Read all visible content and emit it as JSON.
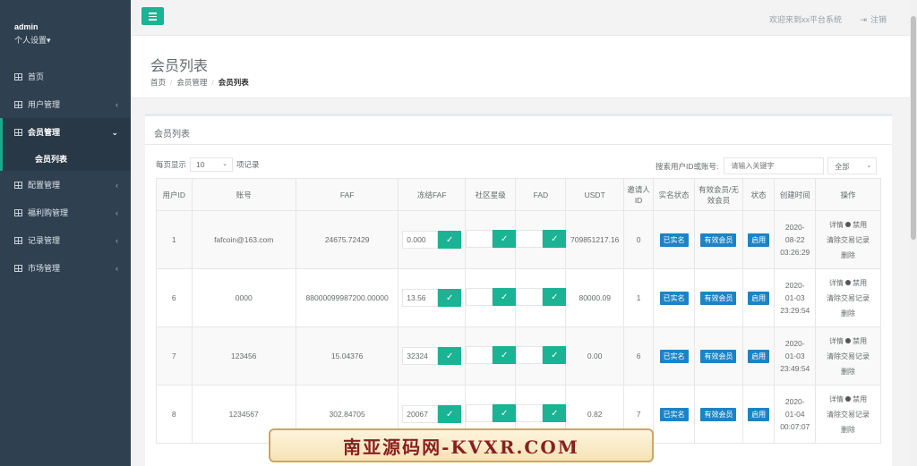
{
  "sidebar": {
    "username": "admin",
    "settings_label": "个人设置",
    "items": [
      {
        "label": "首页",
        "chevron": ""
      },
      {
        "label": "用户管理",
        "chevron": "‹"
      },
      {
        "label": "会员管理",
        "chevron": "⌄"
      },
      {
        "label": "配置管理",
        "chevron": "‹"
      },
      {
        "label": "福利购管理",
        "chevron": "‹"
      },
      {
        "label": "记录管理",
        "chevron": "‹"
      },
      {
        "label": "市场管理",
        "chevron": "‹"
      }
    ],
    "sub_item": "会员列表"
  },
  "topbar": {
    "welcome": "欢迎来到xx平台系统",
    "logout": "注销"
  },
  "heading": {
    "title": "会员列表",
    "breadcrumb": [
      "首页",
      "会员管理",
      "会员列表"
    ]
  },
  "card": {
    "title": "会员列表",
    "page_size_prefix": "每页显示",
    "page_size_value": "10",
    "page_size_suffix": "项记录",
    "search_label": "搜索用户ID或账号:",
    "search_placeholder": "请输入关键字",
    "filter_value": "全部"
  },
  "table": {
    "headers": [
      "用户ID",
      "账号",
      "FAF",
      "冻结FAF",
      "社区星级",
      "FAD",
      "USDT",
      "邀请人ID",
      "实名状态",
      "有效会员/无效会员",
      "状态",
      "创建时间",
      "操作"
    ],
    "rows": [
      {
        "id": "1",
        "account": "fafcoin@163.com",
        "faf": "24675.72429",
        "frozen": "0.000",
        "star": "",
        "fad": "",
        "usdt": "709851217.16",
        "inviter": "0",
        "realname": "已实名",
        "member": "有效会员",
        "status": "启用",
        "date": "2020-",
        "date2": "08-22",
        "time": "03:26:29"
      },
      {
        "id": "6",
        "account": "0000",
        "faf": "88000099987200.00000",
        "frozen": "13.56",
        "star": "",
        "fad": "",
        "usdt": "80000.09",
        "inviter": "1",
        "realname": "已实名",
        "member": "有效会员",
        "status": "启用",
        "date": "2020-",
        "date2": "01-03",
        "time": "23:29:54"
      },
      {
        "id": "7",
        "account": "123456",
        "faf": "15.04376",
        "frozen": "32324",
        "star": "",
        "fad": "",
        "usdt": "0.00",
        "inviter": "6",
        "realname": "已实名",
        "member": "有效会员",
        "status": "启用",
        "date": "2020-",
        "date2": "01-03",
        "time": "23:49:54"
      },
      {
        "id": "8",
        "account": "1234567",
        "faf": "302.84705",
        "frozen": "20067",
        "star": "",
        "fad": "",
        "usdt": "0.82",
        "inviter": "7",
        "realname": "已实名",
        "member": "有效会员",
        "status": "启用",
        "date": "2020-",
        "date2": "01-04",
        "time": "00:07:07"
      }
    ],
    "ops": {
      "detail": "详情",
      "disable": "禁用",
      "clear": "清除交易记录",
      "delete": "删除"
    }
  },
  "watermark": "南亚源码网-KVXR.COM"
}
